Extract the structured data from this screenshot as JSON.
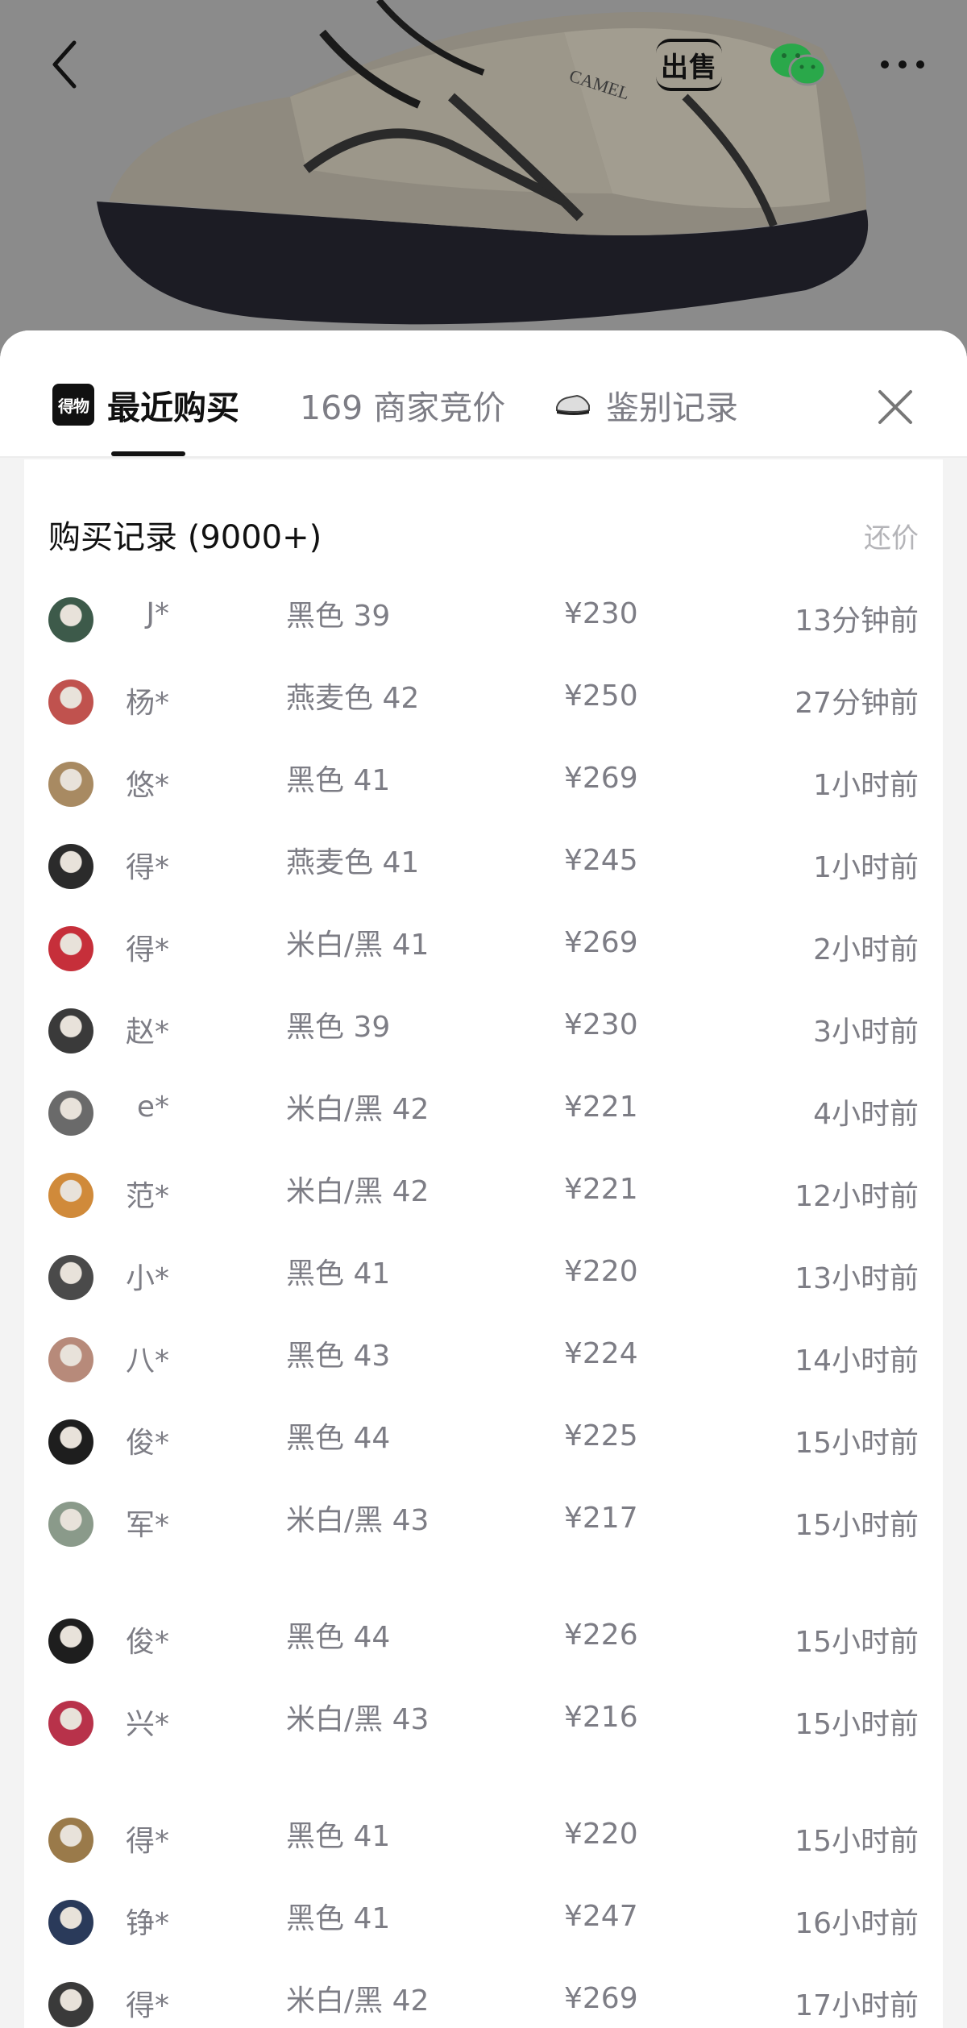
{
  "header": {
    "back_icon": "chevron-left-icon",
    "sell_label": "出售",
    "wechat_icon": "wechat-icon",
    "more_icon": "more-dots-icon",
    "product_brand_print": "CAMEL"
  },
  "tabs": [
    {
      "brand_logo_text": "得物",
      "label": "最近购买",
      "active": true
    },
    {
      "label": "169 商家竞价"
    },
    {
      "label": "鉴别记录",
      "icon": "sneaker-icon"
    }
  ],
  "close_icon": "close-icon",
  "records": {
    "title": "购买记录 (9000+)",
    "action": "还价",
    "rows": [
      {
        "user": "J*",
        "spec": "黑色 39",
        "price": "¥230",
        "time": "13分钟前",
        "avatar_color": "#3d5a4a"
      },
      {
        "user": "杨*",
        "spec": "燕麦色 42",
        "price": "¥250",
        "time": "27分钟前",
        "avatar_color": "#c0524e"
      },
      {
        "user": "悠*",
        "spec": "黑色 41",
        "price": "¥269",
        "time": "1小时前",
        "avatar_color": "#a88a62"
      },
      {
        "user": "得*",
        "spec": "燕麦色 41",
        "price": "¥245",
        "time": "1小时前",
        "avatar_color": "#2b2b2b"
      },
      {
        "user": "得*",
        "spec": "米白/黑 41",
        "price": "¥269",
        "time": "2小时前",
        "avatar_color": "#c62f3a"
      },
      {
        "user": "赵*",
        "spec": "黑色 39",
        "price": "¥230",
        "time": "3小时前",
        "avatar_color": "#3a3a3a"
      },
      {
        "user": "e*",
        "spec": "米白/黑 42",
        "price": "¥221",
        "time": "4小时前",
        "avatar_color": "#6a6a6a"
      },
      {
        "user": "范*",
        "spec": "米白/黑 42",
        "price": "¥221",
        "time": "12小时前",
        "avatar_color": "#d08a3a"
      },
      {
        "user": "小*",
        "spec": "黑色 41",
        "price": "¥220",
        "time": "13小时前",
        "avatar_color": "#4a4a4a"
      },
      {
        "user": "八*",
        "spec": "黑色 43",
        "price": "¥224",
        "time": "14小时前",
        "avatar_color": "#b78a7a"
      },
      {
        "user": "俊*",
        "spec": "黑色 44",
        "price": "¥225",
        "time": "15小时前",
        "avatar_color": "#1e1e1e"
      },
      {
        "user": "军*",
        "spec": "米白/黑 43",
        "price": "¥217",
        "time": "15小时前",
        "avatar_color": "#8a9a8a"
      },
      {
        "user": "俊*",
        "spec": "黑色 44",
        "price": "¥226",
        "time": "15小时前",
        "avatar_color": "#1e1e1e"
      },
      {
        "user": "兴*",
        "spec": "米白/黑 43",
        "price": "¥216",
        "time": "15小时前",
        "avatar_color": "#b8324a"
      },
      {
        "user": "得*",
        "spec": "黑色 41",
        "price": "¥220",
        "time": "15小时前",
        "avatar_color": "#9a7a4a"
      },
      {
        "user": "铮*",
        "spec": "黑色 41",
        "price": "¥247",
        "time": "16小时前",
        "avatar_color": "#2a3a5a"
      },
      {
        "user": "得*",
        "spec": "米白/黑 42",
        "price": "¥269",
        "time": "17小时前",
        "avatar_color": "#3a3a3a"
      }
    ]
  },
  "colors": {
    "overlay": "#7a7a7a",
    "sheet_bg": "#f3f3f3",
    "card_bg": "#ffffff",
    "text_primary": "#111111",
    "text_secondary": "#7d7d85",
    "wechat_green": "#2aa84a"
  }
}
